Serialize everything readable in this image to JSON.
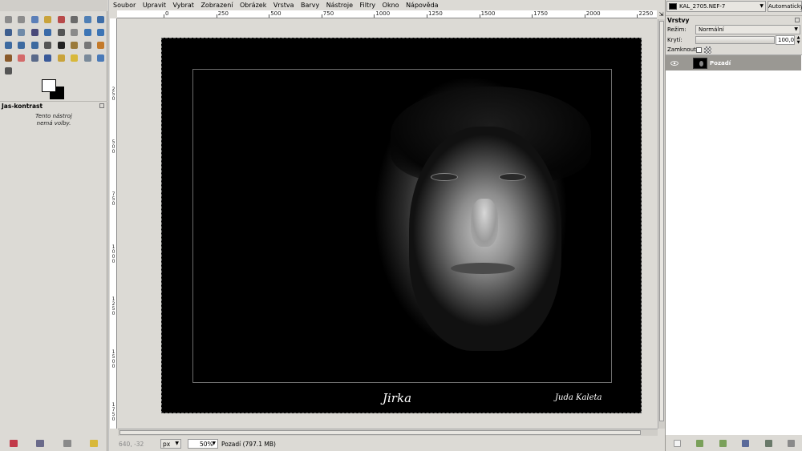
{
  "toolbox": {
    "tools": [
      {
        "icon": "rect-select-icon",
        "color": "#8c8c8c"
      },
      {
        "icon": "ellipse-select-icon",
        "color": "#8c8c8c"
      },
      {
        "icon": "free-select-icon",
        "color": "#5b7fb8"
      },
      {
        "icon": "fuzzy-select-icon",
        "color": "#c9a33b"
      },
      {
        "icon": "select-by-color-icon",
        "color": "#b84a4a"
      },
      {
        "icon": "scissors-select-icon",
        "color": "#6a6a6a"
      },
      {
        "icon": "foreground-select-icon",
        "color": "#4f7fb5"
      },
      {
        "icon": "paths-icon",
        "color": "#3e6ea8"
      },
      {
        "icon": "color-picker-icon",
        "color": "#3f5f8f"
      },
      {
        "icon": "zoom-icon",
        "color": "#6f8aa8"
      },
      {
        "icon": "measure-icon",
        "color": "#4a4a7a"
      },
      {
        "icon": "move-icon",
        "color": "#3a6aa8"
      },
      {
        "icon": "align-icon",
        "color": "#555555"
      },
      {
        "icon": "crop-icon",
        "color": "#8a8a8a"
      },
      {
        "icon": "rotate-icon",
        "color": "#3d75b5"
      },
      {
        "icon": "scale-icon",
        "color": "#3d75b5"
      },
      {
        "icon": "shear-icon",
        "color": "#3d6aa0"
      },
      {
        "icon": "perspective-icon",
        "color": "#3d6aa0"
      },
      {
        "icon": "flip-icon",
        "color": "#3d6aa0"
      },
      {
        "icon": "cage-icon",
        "color": "#555555"
      },
      {
        "icon": "text-icon",
        "color": "#222222"
      },
      {
        "icon": "bucket-fill-icon",
        "color": "#9a7a3a"
      },
      {
        "icon": "blend-icon",
        "color": "#777777"
      },
      {
        "icon": "pencil-icon",
        "color": "#c47a2a"
      },
      {
        "icon": "paintbrush-icon",
        "color": "#8a5a2a"
      },
      {
        "icon": "eraser-icon",
        "color": "#d46a6a"
      },
      {
        "icon": "airbrush-icon",
        "color": "#5a6a8a"
      },
      {
        "icon": "ink-icon",
        "color": "#3a5a9a"
      },
      {
        "icon": "clone-icon",
        "color": "#c9a33b"
      },
      {
        "icon": "heal-icon",
        "color": "#d8b83a"
      },
      {
        "icon": "perspective-clone-icon",
        "color": "#7a8a9a"
      },
      {
        "icon": "blur-icon",
        "color": "#4a7ab8"
      },
      {
        "icon": "smudge-icon",
        "color": "#555555"
      }
    ],
    "fg_color": "#ffffff",
    "bg_color": "#000000",
    "options_title": "Jas-kontrast",
    "options_line1": "Tento nástroj",
    "options_line2": "nemá volby.",
    "bottom_icons": [
      "save-options-icon",
      "restore-options-icon",
      "delete-options-icon",
      "reset-options-icon"
    ]
  },
  "menubar": [
    "Soubor",
    "Upravit",
    "Vybrat",
    "Zobrazení",
    "Obrázek",
    "Vrstva",
    "Barvy",
    "Nástroje",
    "Filtry",
    "Okno",
    "Nápověda"
  ],
  "hruler": [
    "0",
    "250",
    "500",
    "750",
    "1000",
    "1250",
    "1500",
    "1750",
    "2000",
    "2250"
  ],
  "vruler": [
    "250",
    "500",
    "750",
    "1000",
    "1250",
    "1500",
    "1750"
  ],
  "canvas": {
    "signature_left": "Jirka",
    "signature_right": "Juda Kaleta"
  },
  "status": {
    "coords": "640, -32",
    "unit": "px",
    "zoom": "50%",
    "message": "Pozadí (797.1 MB)"
  },
  "dock": {
    "image_name": "KAL_2705.NEF-7",
    "auto_label": "Automaticky",
    "layers_title": "Vrstvy",
    "mode_label": "Režim:",
    "mode_value": "Normální",
    "opacity_label": "Krytí:",
    "opacity_value": "100,0",
    "lock_label": "Zamknout:",
    "layer_name": "Pozadí",
    "bottom_icons": [
      "new-layer-icon",
      "raise-layer-icon",
      "lower-layer-icon",
      "duplicate-layer-icon",
      "anchor-layer-icon",
      "delete-layer-icon"
    ]
  }
}
